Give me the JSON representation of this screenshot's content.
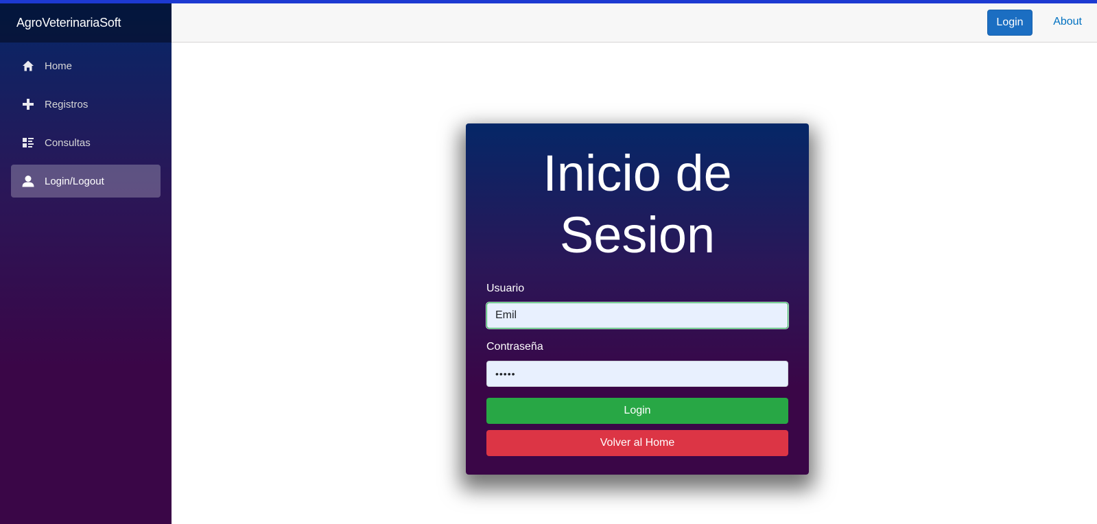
{
  "app": {
    "brand": "AgroVeterinariaSoft"
  },
  "sidebar": {
    "items": [
      {
        "label": "Home",
        "icon": "home-icon",
        "active": false
      },
      {
        "label": "Registros",
        "icon": "plus-icon",
        "active": false
      },
      {
        "label": "Consultas",
        "icon": "list-icon",
        "active": false
      },
      {
        "label": "Login/Logout",
        "icon": "person-icon",
        "active": true
      }
    ]
  },
  "topbar": {
    "login_label": "Login",
    "about_label": "About"
  },
  "login_form": {
    "title": "Inicio de Sesion",
    "username_label": "Usuario",
    "username_value": "Emil",
    "password_label": "Contraseña",
    "password_display": "•••••",
    "submit_label": "Login",
    "back_label": "Volver al Home"
  },
  "colors": {
    "accent_blue": "#1b6ec2",
    "success_green": "#28a745",
    "danger_red": "#dc3545",
    "sidebar_top": "#052767",
    "sidebar_bottom": "#3a0647"
  }
}
